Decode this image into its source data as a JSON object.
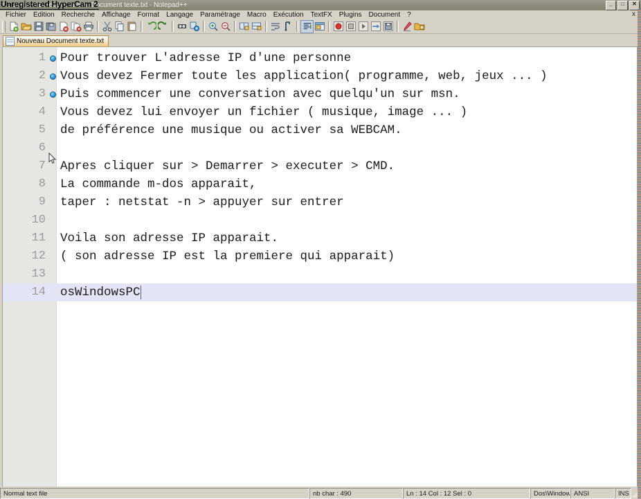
{
  "window": {
    "title": "s\\Computer\\Bureau\\Nouveau Document texte.txt - Notepad++",
    "watermark": "Unregistered HyperCam 2",
    "minimize_label": "_",
    "maximize_label": "□",
    "close_label": "✕",
    "doc_close_label": "x"
  },
  "menu": {
    "items": [
      {
        "label": "Fichier"
      },
      {
        "label": "Edition"
      },
      {
        "label": "Recherche"
      },
      {
        "label": "Affichage"
      },
      {
        "label": "Format"
      },
      {
        "label": "Langage"
      },
      {
        "label": "Paramétrage"
      },
      {
        "label": "Macro"
      },
      {
        "label": "Exécution"
      },
      {
        "label": "TextFX"
      },
      {
        "label": "Plugins"
      },
      {
        "label": "Document"
      },
      {
        "label": "?"
      }
    ]
  },
  "toolbar": {
    "buttons": [
      {
        "name": "new-file-icon"
      },
      {
        "name": "open-file-icon"
      },
      {
        "name": "save-icon"
      },
      {
        "name": "save-all-icon"
      },
      {
        "name": "close-file-icon"
      },
      {
        "name": "close-all-files-icon"
      },
      {
        "name": "print-icon"
      },
      {
        "name": "cut-icon"
      },
      {
        "name": "copy-icon"
      },
      {
        "name": "paste-icon"
      },
      {
        "name": "undo-icon"
      },
      {
        "name": "redo-icon"
      },
      {
        "name": "find-icon"
      },
      {
        "name": "replace-icon"
      },
      {
        "name": "zoom-in-icon"
      },
      {
        "name": "zoom-out-icon"
      },
      {
        "name": "sync-vertical-icon"
      },
      {
        "name": "sync-horizontal-icon"
      },
      {
        "name": "word-wrap-icon"
      },
      {
        "name": "show-whitespace-icon"
      },
      {
        "name": "indent-guide-icon"
      },
      {
        "name": "user-define-dialog-icon"
      },
      {
        "name": "macro-record-icon"
      },
      {
        "name": "macro-stop-icon"
      },
      {
        "name": "macro-play-icon"
      },
      {
        "name": "macro-playback-multiple-icon"
      },
      {
        "name": "macro-save-icon"
      },
      {
        "name": "text-highlight-icon"
      },
      {
        "name": "folder-as-workspace-icon"
      }
    ]
  },
  "tab": {
    "label": "Nouveau Document texte.txt"
  },
  "editor": {
    "lines": [
      {
        "num": "1",
        "text": "Pour trouver L'adresse IP d'une personne",
        "bookmark": true,
        "active": false
      },
      {
        "num": "2",
        "text": "Vous devez Fermer toute les application( programme, web, jeux ... )",
        "bookmark": true,
        "active": false
      },
      {
        "num": "3",
        "text": "Puis commencer une conversation avec quelqu'un sur msn.",
        "bookmark": true,
        "active": false
      },
      {
        "num": "4",
        "text": "Vous devez lui envoyer un fichier ( musique, image ... )",
        "bookmark": false,
        "active": false
      },
      {
        "num": "5",
        "text": "de préférence une musique ou activer sa WEBCAM.",
        "bookmark": false,
        "active": false
      },
      {
        "num": "6",
        "text": "",
        "bookmark": false,
        "active": false
      },
      {
        "num": "7",
        "text": "Apres cliquer sur > Demarrer > executer > CMD.",
        "bookmark": false,
        "active": false
      },
      {
        "num": "8",
        "text": "La commande m-dos apparait,",
        "bookmark": false,
        "active": false
      },
      {
        "num": "9",
        "text": "taper : netstat -n > appuyer sur entrer",
        "bookmark": false,
        "active": false
      },
      {
        "num": "10",
        "text": "",
        "bookmark": false,
        "active": false
      },
      {
        "num": "11",
        "text": "Voila son adresse IP apparait.",
        "bookmark": false,
        "active": false
      },
      {
        "num": "12",
        "text": "( son adresse IP est la premiere qui apparait)",
        "bookmark": false,
        "active": false
      },
      {
        "num": "13",
        "text": "",
        "bookmark": false,
        "active": false
      },
      {
        "num": "14",
        "text": "osWindowsPC",
        "bookmark": false,
        "active": true
      }
    ]
  },
  "statusbar": {
    "file_type": "Normal text file",
    "char_count": "nb char : 490",
    "position": "Ln : 14   Col : 12   Sel : 0",
    "eol": "Dos\\Windows",
    "encoding": "ANSI",
    "insert_mode": "INS"
  }
}
